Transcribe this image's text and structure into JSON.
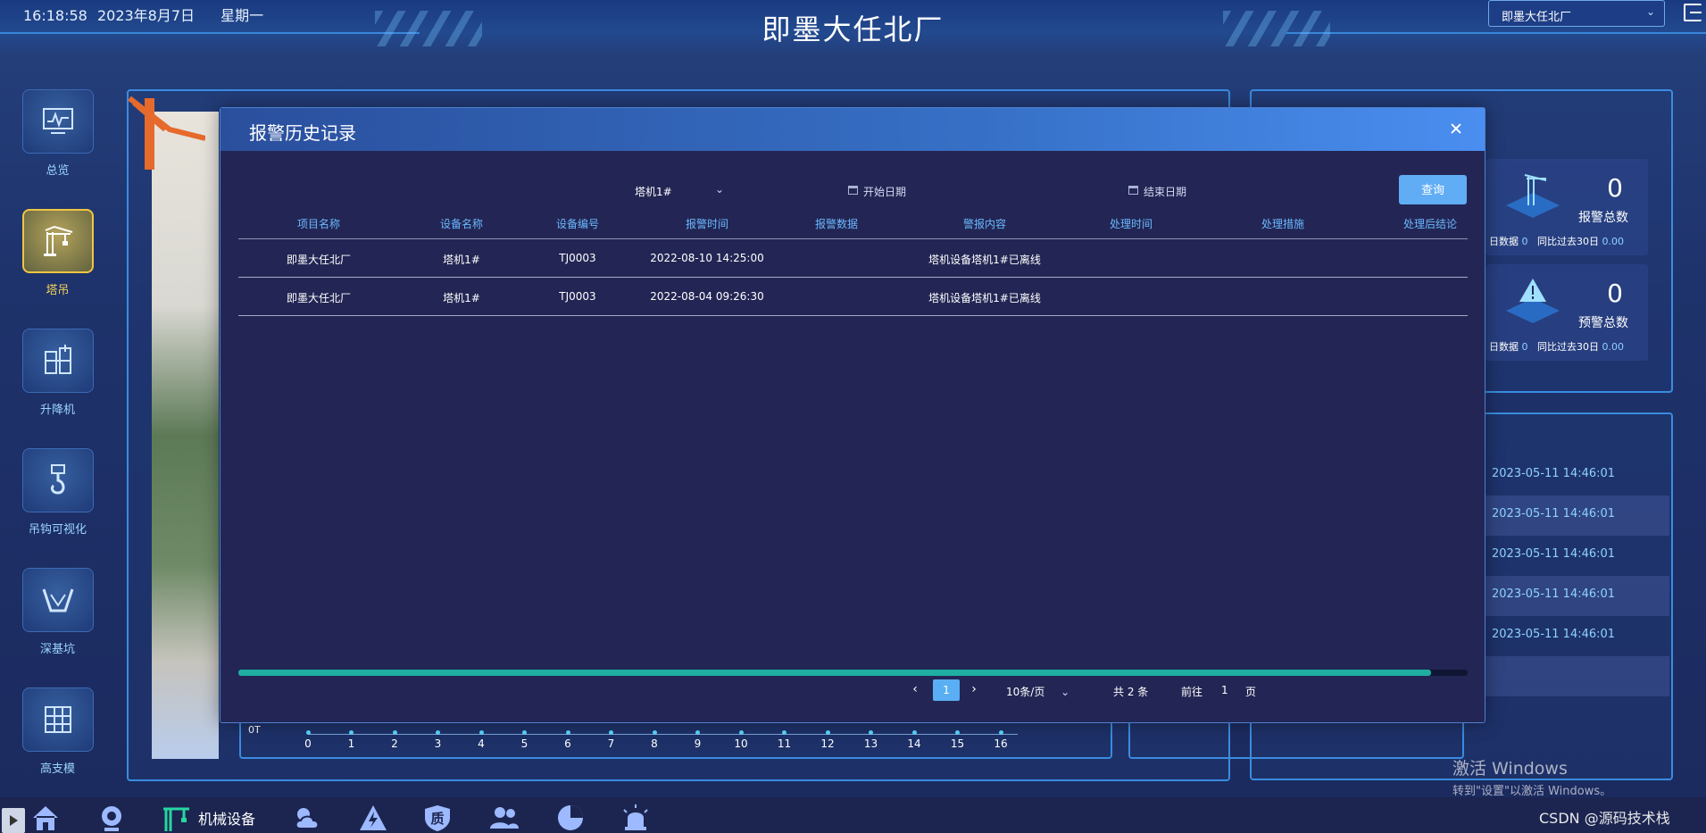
{
  "header": {
    "time": "16:18:58",
    "date": "2023年8月7日",
    "weekday": "星期一",
    "title": "即墨大任北厂",
    "site_select": "即墨大任北厂"
  },
  "leftnav": [
    {
      "label": "总览",
      "icon": "monitor-icon"
    },
    {
      "label": "塔吊",
      "icon": "tower-crane-icon",
      "active": true
    },
    {
      "label": "升降机",
      "icon": "elevator-icon"
    },
    {
      "label": "吊钩可视化",
      "icon": "hook-icon"
    },
    {
      "label": "深基坑",
      "icon": "foundation-pit-icon"
    },
    {
      "label": "高支模",
      "icon": "formwork-icon"
    }
  ],
  "stats": [
    {
      "value": "0",
      "name": "报警总数",
      "sub_a": "日数据",
      "sub_a_val": "0",
      "sub_b": "同比过去30日",
      "sub_b_val": "0.00"
    },
    {
      "value": "0",
      "name": "预警总数",
      "sub_a": "日数据",
      "sub_a_val": "0",
      "sub_b": "同比过去30日",
      "sub_b_val": "0.00"
    }
  ],
  "side_times": [
    "2023-05-11 14:46:01",
    "2023-05-11 14:46:01",
    "2023-05-11 14:46:01",
    "2023-05-11 14:46:01",
    "2023-05-11 14:46:01"
  ],
  "axis": {
    "ot": "0T",
    "ticks": [
      "0",
      "1",
      "2",
      "3",
      "4",
      "5",
      "6",
      "7",
      "8",
      "9",
      "10",
      "11",
      "12",
      "13",
      "14",
      "15",
      "16"
    ]
  },
  "bottombar": {
    "machinery_label": "机械设备",
    "quality_char": "质"
  },
  "watermark": {
    "line1": "激活 Windows",
    "line2": "转到\"设置\"以激活 Windows。",
    "csdn": "CSDN @源码技术栈"
  },
  "modal": {
    "title": "报警历史记录",
    "filter_crane": "塔机1#",
    "start_date_placeholder": "开始日期",
    "end_date_placeholder": "结束日期",
    "query_label": "查询",
    "columns": [
      "项目名称",
      "设备名称",
      "设备编号",
      "报警时间",
      "报警数据",
      "警报内容",
      "处理时间",
      "处理措施",
      "处理后结论"
    ],
    "rows": [
      {
        "project": "即墨大任北厂",
        "device": "塔机1#",
        "code": "TJ0003",
        "time": "2022-08-10 14:25:00",
        "data": "",
        "content": "塔机设备塔机1#已离线",
        "handle_time": "",
        "measure": "",
        "conclusion": ""
      },
      {
        "project": "即墨大任北厂",
        "device": "塔机1#",
        "code": "TJ0003",
        "time": "2022-08-04 09:26:30",
        "data": "",
        "content": "塔机设备塔机1#已离线",
        "handle_time": "",
        "measure": "",
        "conclusion": ""
      }
    ],
    "scroll_fraction": 0.97,
    "pager": {
      "current": "1",
      "page_size": "10条/页",
      "total": "共 2 条",
      "goto_prefix": "前往",
      "goto_value": "1",
      "goto_suffix": "页"
    }
  },
  "colors": {
    "accent": "#61adf5",
    "header_blue": "#3670c6",
    "active_nav": "#f0c542",
    "modal_bg": "#232654"
  }
}
